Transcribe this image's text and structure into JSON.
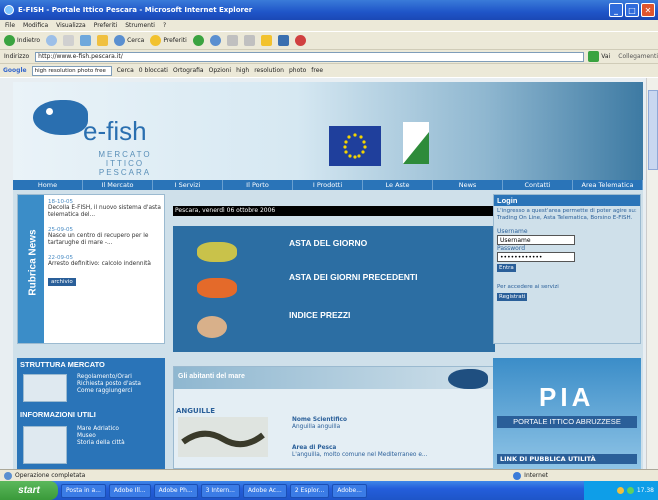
{
  "window": {
    "title": "E-FISH - Portale Ittico Pescara - Microsoft Internet Explorer"
  },
  "menu": [
    "File",
    "Modifica",
    "Visualizza",
    "Preferiti",
    "Strumenti",
    "?"
  ],
  "toolbar": {
    "back": "Indietro",
    "search": "Cerca",
    "favorites": "Preferiti"
  },
  "address": {
    "label": "Indirizzo",
    "url": "http://www.e-fish.pescara.it/",
    "go": "Vai",
    "links": "Collegamenti"
  },
  "googlebar": {
    "brand": "Google",
    "query": "high resolution photo free",
    "items": [
      "Cerca",
      "0 bloccati",
      "Ortografia",
      "Opzioni",
      "high",
      "resolution",
      "photo",
      "free"
    ]
  },
  "site": {
    "logo": {
      "name": "e-fish",
      "sub1": "MERCATO ITTICO",
      "sub2": "PESCARA"
    },
    "nav": [
      "Home",
      "Il Mercato",
      "I Servizi",
      "Il Porto",
      "I Prodotti",
      "Le Aste",
      "News",
      "Contatti",
      "Area Telematica"
    ],
    "rubrica": {
      "title": "Rubrica News",
      "items": [
        {
          "date": "18-10-05",
          "text": "Decolla E-FISH, il nuovo sistema d'asta telematica del..."
        },
        {
          "date": "25-09-05",
          "text": "Nasce un centro di recupero per le tartarughe di mare -..."
        },
        {
          "date": "22-09-05",
          "text": "Arresto definitivo: calcolo indennità"
        }
      ],
      "archivio": "archivio"
    },
    "date_bar": "Pescara, venerdì 06 ottobre 2006",
    "center_items": [
      "ASTA DEL GIORNO",
      "ASTA DEI GIORNI PRECEDENTI",
      "INDICE PREZZI"
    ],
    "login": {
      "title": "Login",
      "desc": "L'ingresso a quest'area permette di poter agire su: Trading On Line, Asta Telematica, Borsino E-FISH.",
      "username_label": "Username",
      "username_value": "Username",
      "password_label": "Password",
      "password_value": "••••••••••••",
      "enter": "Entra",
      "note": "Per accedere ai servizi",
      "register": "Registrati"
    },
    "struttura": {
      "title": "STRUTTURA MERCATO",
      "links": [
        "Regolamento/Orari",
        "Richiesta posto d'asta",
        "Come raggiungerci"
      ],
      "info_title": "INFORMAZIONI UTILI",
      "info_links": [
        "Mare Adriatico",
        "Museo",
        "Storia della città"
      ]
    },
    "abitanti": {
      "title": "Gli abitanti del mare",
      "species": "ANGUILLE",
      "sci_label": "Nome Scientifico",
      "sci_value": "Anguilla anguilla",
      "area_label": "Area di Pesca",
      "area_value": "L'anguilla, molto comune nel Mediterraneo e..."
    },
    "pia": {
      "big": "PIA",
      "portale": "PORTALE ITTICO ABRUZZESE",
      "link": "LINK DI PUBBLICA UTILITÀ"
    }
  },
  "status": {
    "text": "Operazione completata",
    "zone": "Internet"
  },
  "taskbar": {
    "start": "start",
    "tasks": [
      "Posta in a...",
      "Adobe Ill...",
      "Adobe Ph...",
      "3 Intern...",
      "Adobe Ac...",
      "2 Esplor...",
      "Adobe..."
    ],
    "clock": "17.38"
  }
}
